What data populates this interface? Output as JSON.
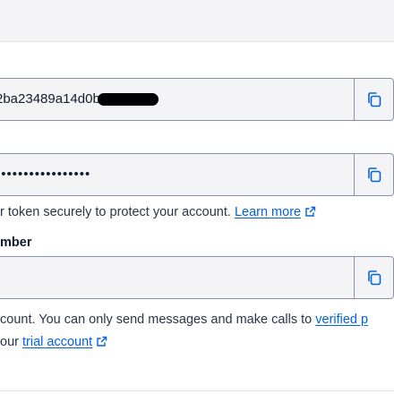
{
  "account_sid": {
    "value": "2ba23489a14d0b",
    "copy_icon": "copy-icon"
  },
  "auth_token": {
    "value": "•••••••••••••••••",
    "copy_icon": "copy-icon",
    "help_text": "r token securely to protect your account.",
    "learn_more": "Learn more",
    "link_icon": "external-link-icon"
  },
  "phone_number": {
    "label": "mber",
    "value": "",
    "copy_icon": "copy-icon",
    "help_line1_text": "count. You can only send messages and make calls to ",
    "help_line1_link": "verified p",
    "help_line2_prefix": "our ",
    "help_line2_link": "trial account",
    "link_icon": "external-link-icon"
  },
  "colors": {
    "link": "#0263e0",
    "field_bg": "#f4f4f6",
    "field_border": "#8891aa"
  }
}
